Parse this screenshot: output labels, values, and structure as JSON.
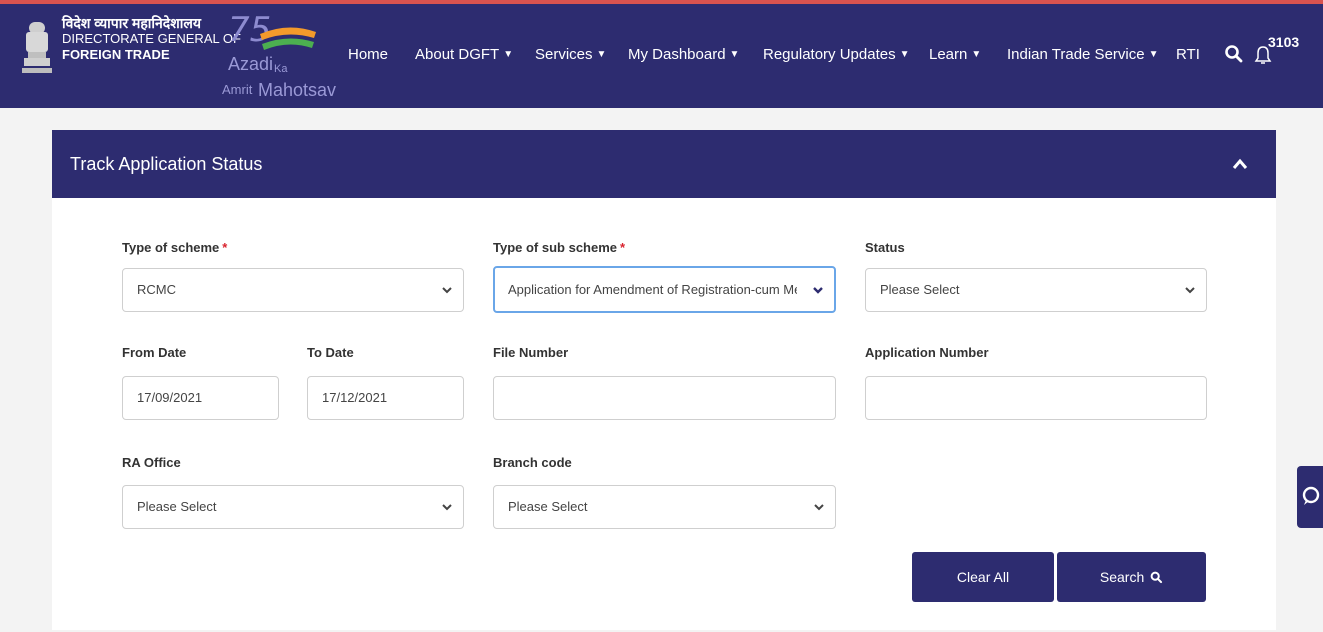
{
  "header": {
    "org_hindi": "विदेश व्यापार महानिदेशालय",
    "org_line1": "DIRECTORATE GENERAL OF",
    "org_line2": "FOREIGN TRADE",
    "azadi": {
      "num": "75",
      "line1": "Azadi",
      "ka": "Ka",
      "amrit": "Amrit",
      "mahotsav": "Mahotsav"
    },
    "nav": [
      {
        "label": "Home",
        "caret": false
      },
      {
        "label": "About DGFT",
        "caret": true
      },
      {
        "label": "Services",
        "caret": true
      },
      {
        "label": "My Dashboard",
        "caret": true
      },
      {
        "label": "Regulatory Updates",
        "caret": true
      },
      {
        "label": "Learn",
        "caret": true
      },
      {
        "label": "Indian Trade Service",
        "caret": true
      },
      {
        "label": "RTI",
        "caret": false
      }
    ],
    "notification_count": "3103"
  },
  "panel": {
    "title": "Track Application Status",
    "type_of_scheme": {
      "label": "Type of scheme",
      "value": "RCMC"
    },
    "type_of_sub_scheme": {
      "label": "Type of sub scheme",
      "value": "Application for Amendment of Registration-cum Memb"
    },
    "status": {
      "label": "Status",
      "value": "Please Select"
    },
    "from_date": {
      "label": "From Date",
      "value": "17/09/2021"
    },
    "to_date": {
      "label": "To Date",
      "value": "17/12/2021"
    },
    "file_number": {
      "label": "File Number",
      "value": ""
    },
    "application_number": {
      "label": "Application Number",
      "value": ""
    },
    "ra_office": {
      "label": "RA Office",
      "value": "Please Select"
    },
    "branch_code": {
      "label": "Branch code",
      "value": "Please Select"
    },
    "required_mark": "*",
    "clear_label": "Clear All",
    "search_label": "Search"
  },
  "colors": {
    "primary": "#2d2c70",
    "required": "#d9232e",
    "focus": "#6aa6e8",
    "top_border": "#d9534f"
  }
}
